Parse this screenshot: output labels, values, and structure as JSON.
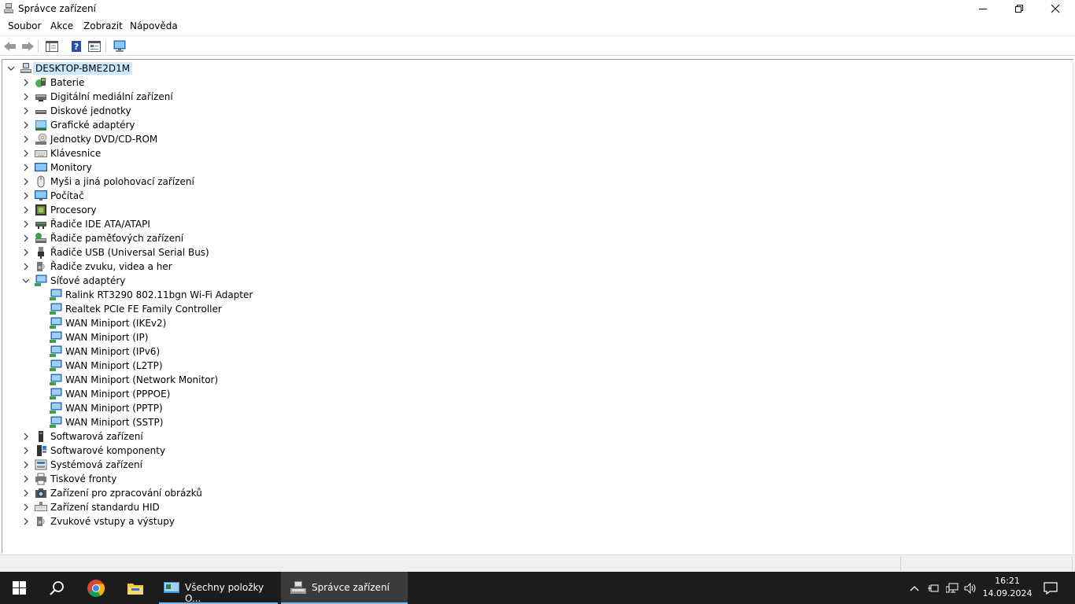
{
  "window": {
    "title": "Správce zařízení"
  },
  "menu": [
    "Soubor",
    "Akce",
    "Zobrazit",
    "Nápověda"
  ],
  "tree": {
    "root": "DESKTOP-BME2D1M",
    "categories": [
      "Baterie",
      "Digitální mediální zařízení",
      "Diskové jednotky",
      "Grafické adaptéry",
      "Jednotky DVD/CD-ROM",
      "Klávesnice",
      "Monitory",
      "Myši a jiná polohovací zařízení",
      "Počítač",
      "Procesory",
      "Řadiče IDE ATA/ATAPI",
      "Řadiče paměťových zařízení",
      "Řadiče USB (Universal Serial Bus)",
      "Řadiče zvuku, videa a her",
      "Síťové adaptéry"
    ],
    "network_children": [
      "Ralink RT3290 802.11bgn Wi-Fi Adapter",
      "Realtek PCIe FE Family Controller",
      "WAN Miniport (IKEv2)",
      "WAN Miniport (IP)",
      "WAN Miniport (IPv6)",
      "WAN Miniport (L2TP)",
      "WAN Miniport (Network Monitor)",
      "WAN Miniport (PPPOE)",
      "WAN Miniport (PPTP)",
      "WAN Miniport (SSTP)"
    ],
    "categories_after": [
      "Softwarová zařízení",
      "Softwarové komponenty",
      "Systémová zařízení",
      "Tiskové fronty",
      "Zařízení pro zpracování obrázků",
      "Zařízení standardu HID",
      "Zvukové vstupy a výstupy"
    ]
  },
  "taskbar": {
    "tasks": [
      {
        "label": "Všechny položky O..."
      },
      {
        "label": "Správce zařízení"
      }
    ],
    "clock": {
      "time": "16:21",
      "date": "14.09.2024"
    }
  }
}
